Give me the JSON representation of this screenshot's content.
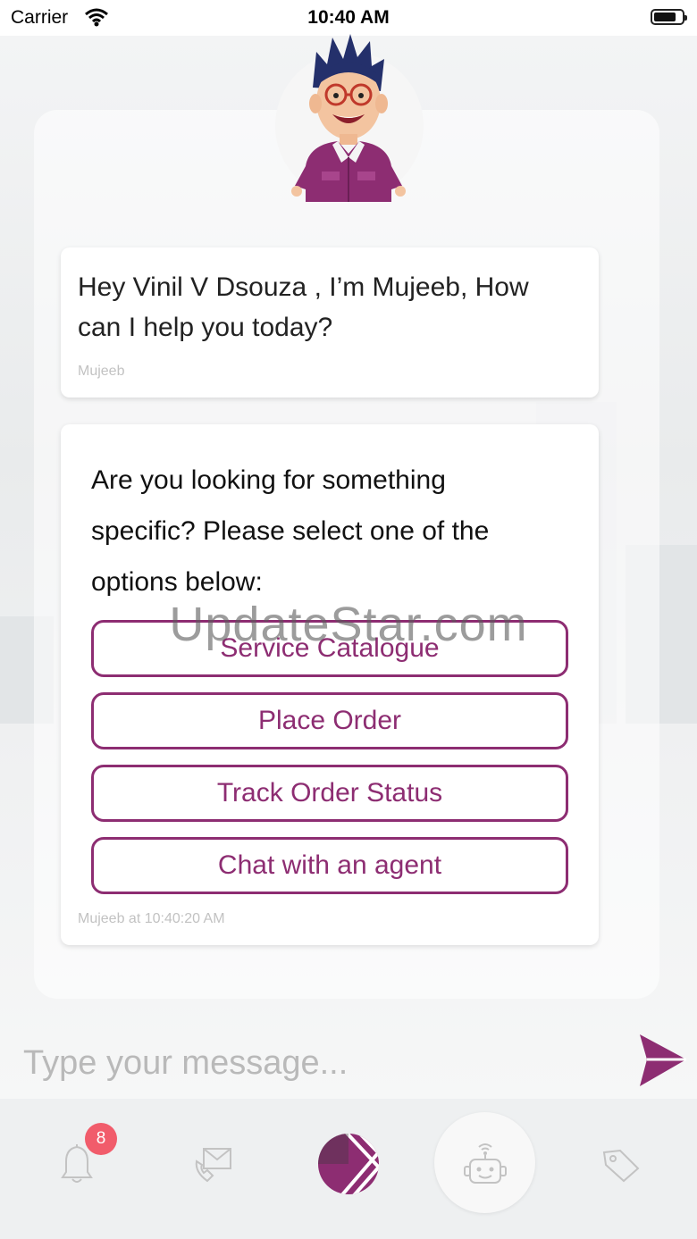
{
  "status_bar": {
    "carrier": "Carrier",
    "time": "10:40 AM"
  },
  "bot": {
    "avatar_icon": "mujeeb-avatar-icon"
  },
  "messages": [
    {
      "text": "Hey Vinil V Dsouza , I’m Mujeeb, How can I help you today?",
      "sender": "Mujeeb"
    },
    {
      "text": "Are you looking for something specific? Please select one of the options below:",
      "options": [
        "Service Catalogue",
        "Place Order",
        "Track Order Status",
        "Chat with an agent"
      ],
      "sender": "Mujeeb at 10:40:20 AM"
    }
  ],
  "watermark": "UpdateStar.com",
  "composer": {
    "placeholder": "Type your message...",
    "send_icon": "send-icon"
  },
  "tabbar": {
    "notifications_badge": "8",
    "icons": [
      "bell-icon",
      "mail-phone-icon",
      "brand-logo-icon",
      "chatbot-icon",
      "tag-icon"
    ]
  },
  "colors": {
    "accent": "#8d2d72",
    "badge": "#f15c6b"
  }
}
